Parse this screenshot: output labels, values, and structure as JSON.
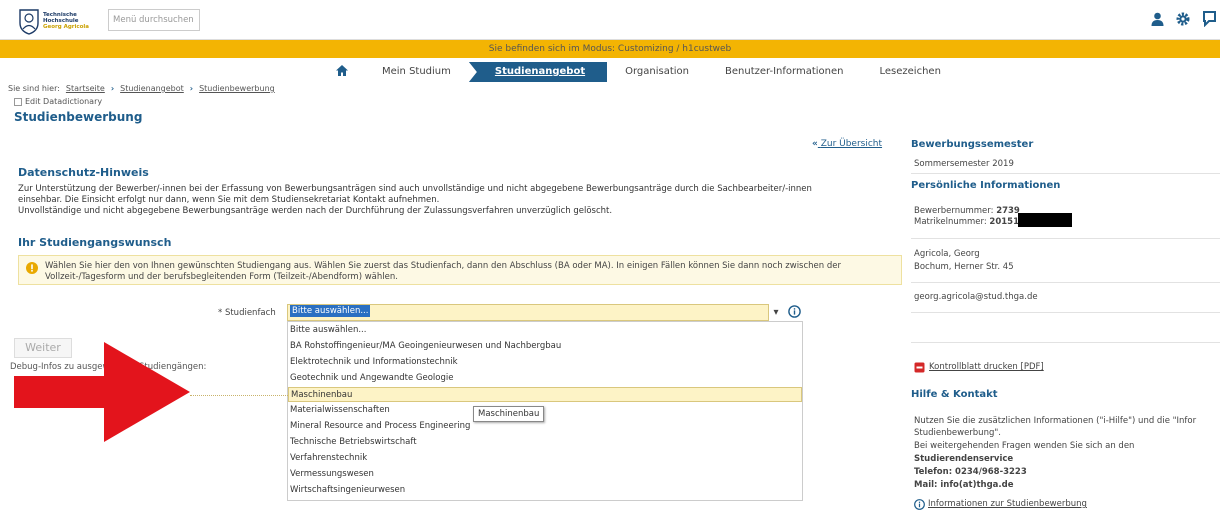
{
  "header": {
    "logo": {
      "line1": "Technische",
      "line2": "Hochschule",
      "line3": "Georg Agricola"
    },
    "search_placeholder": "Menü durchsuchen",
    "icons": [
      "user-icon",
      "gear-icon",
      "chat-icon"
    ]
  },
  "modebar": {
    "text": "Sie befinden sich im Modus: Customizing / h1custweb"
  },
  "nav": {
    "items": [
      "Mein Studium",
      "Studienangebot",
      "Organisation",
      "Benutzer-Informationen",
      "Lesezeichen"
    ],
    "active": "Studienangebot"
  },
  "breadcrumb": {
    "prefix": "Sie sind hier:",
    "items": [
      "Startseite",
      "Studienangebot",
      "Studienbewerbung"
    ]
  },
  "edit_datadictionary": "Edit Datadictionary",
  "page_title": "Studienbewerbung",
  "zur_uebersicht": "Zur Übersicht",
  "datenschutz": {
    "title": "Datenschutz-Hinweis",
    "line1": "Zur Unterstützung der Bewerber/-innen bei der Erfassung von Bewerbungsanträgen sind auch unvollständige und nicht abgegebene Bewerbungsanträge durch die Sachbearbeiter/-innen",
    "line2": "einsehbar. Die Einsicht erfolgt nur dann, wenn Sie mit dem Studiensekretariat Kontakt aufnehmen.",
    "line3": "Unvollständige und nicht abgegebene Bewerbungsanträge werden nach der Durchführung der Zulassungsverfahren unverzüglich gelöscht."
  },
  "wunsch": {
    "title": "Ihr Studiengangswunsch",
    "info_line1": "Wählen Sie hier den von Ihnen gewünschten Studiengang aus. Wählen Sie zuerst das Studienfach, dann den Abschluss (BA oder MA). In einigen Fällen können Sie dann noch zwischen der",
    "info_line2": "Vollzeit-/Tagesform und der berufsbegleitenden Form (Teilzeit-/Abendform) wählen."
  },
  "studienfach": {
    "label": "* Studienfach",
    "value": "Bitte auswählen...",
    "options": [
      "Bitte auswählen...",
      "BA Rohstoffingenieur/MA Geoingenieurwesen und Nachbergbau",
      "Elektrotechnik und Informationstechnik",
      "Geotechnik und Angewandte Geologie",
      "Maschinenbau",
      "Materialwissenschaften",
      "Mineral Resource and Process Engineering",
      "Technische Betriebswirtschaft",
      "Verfahrenstechnik",
      "Vermessungswesen",
      "Wirtschaftsingenieurwesen"
    ],
    "highlighted": "Maschinenbau",
    "tooltip": "Maschinenbau"
  },
  "weiter_label": "Weiter",
  "debug_text": "Debug-Infos zu ausgewählten Studiengängen:",
  "sidebar": {
    "semester_title": "Bewerbungssemester",
    "semester_value": "Sommersemester 2019",
    "persoenlich_title": "Persönliche Informationen",
    "bewerbernummer_label": "Bewerbernummer:",
    "bewerbernummer_value": "2739",
    "matrikel_label": "Matrikelnummer:",
    "matrikel_value": "20151",
    "name": "Agricola, Georg",
    "address": "Bochum, Herner Str. 45",
    "email": "georg.agricola@stud.thga.de",
    "kontrollblatt": "Kontrollblatt drucken [PDF]",
    "hilfe_title": "Hilfe & Kontakt",
    "hilfe_line1": "Nutzen Sie die zusätzlichen Informationen (\"i-Hilfe\") und die \"Infor",
    "hilfe_line2": "Studienbewerbung\".",
    "hilfe_line3": "Bei weitergehenden Fragen wenden Sie sich an den",
    "service": "Studierendenservice",
    "telefon": "Telefon: 0234/968-3223",
    "mail": "Mail: info(at)thga.de",
    "info_link": "Informationen zur Studienbewerbung"
  }
}
